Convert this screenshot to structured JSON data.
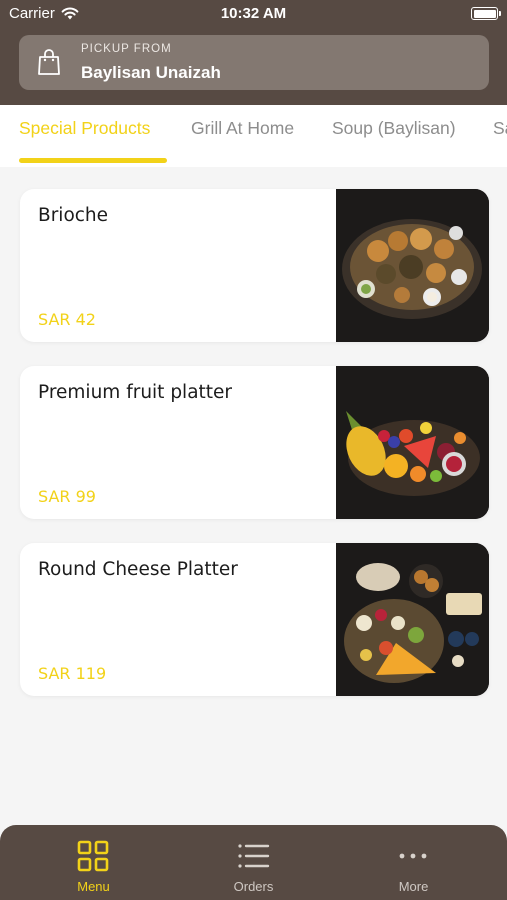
{
  "status_bar": {
    "carrier": "Carrier",
    "time": "10:32 AM"
  },
  "pickup": {
    "label": "PICKUP FROM",
    "value": "Baylisan Unaizah"
  },
  "tabs": [
    {
      "label": "Special Products",
      "active": true
    },
    {
      "label": "Grill At Home",
      "active": false
    },
    {
      "label": "Soup (Baylisan)",
      "active": false
    },
    {
      "label": "Sa",
      "active": false
    }
  ],
  "products": [
    {
      "name": "Brioche",
      "price": "SAR 42",
      "image": "brioche-platter-photo"
    },
    {
      "name": "Premium fruit platter",
      "price": "SAR 99",
      "image": "fruit-platter-photo"
    },
    {
      "name": "Round Cheese Platter",
      "price": "SAR 119",
      "image": "cheese-platter-photo"
    }
  ],
  "bottom_nav": [
    {
      "label": "Menu",
      "icon": "grid-icon",
      "active": true
    },
    {
      "label": "Orders",
      "icon": "list-icon",
      "active": false
    },
    {
      "label": "More",
      "icon": "more-dots-icon",
      "active": false
    }
  ],
  "colors": {
    "header": "#574a43",
    "accent": "#f2d219",
    "pickup_box": "#837871",
    "background": "#f5f5f5"
  }
}
